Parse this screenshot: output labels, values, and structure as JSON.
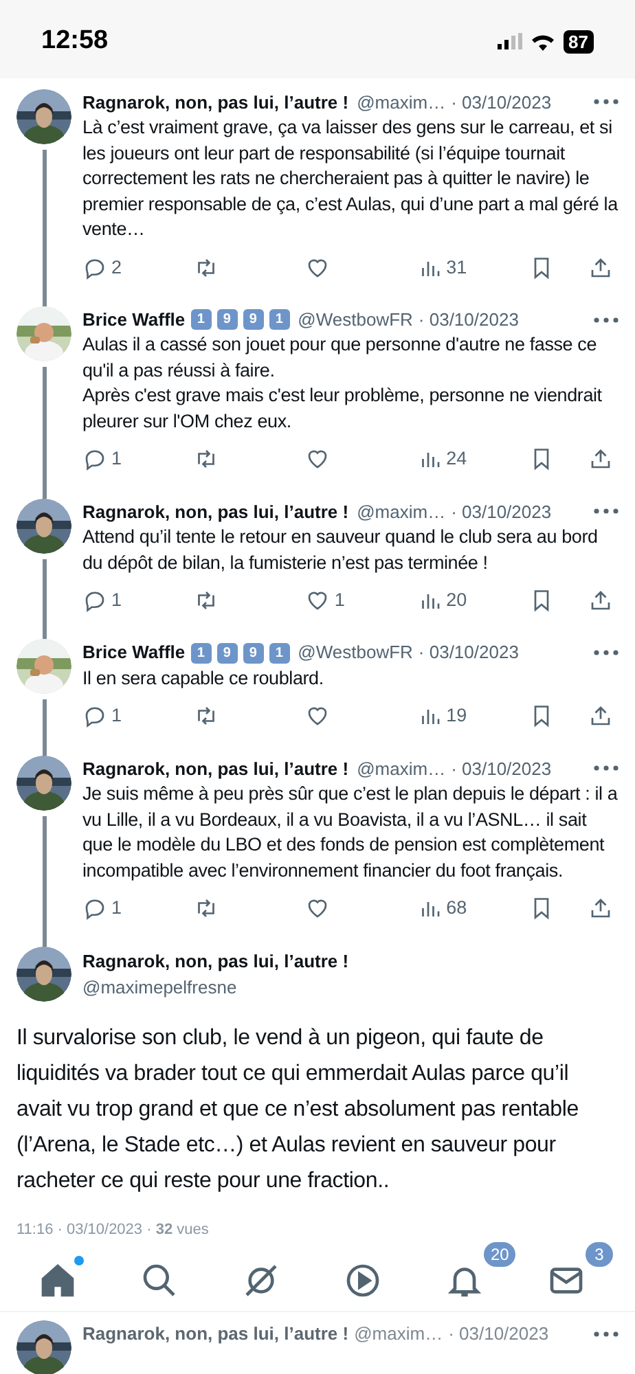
{
  "status_bar": {
    "time": "12:58",
    "battery": "87"
  },
  "replies": [
    {
      "name": "Ragnarok, non, pas lui, l’autre !",
      "handle": "@maxim…",
      "date": "· 03/10/2023",
      "text": "Là c’est vraiment grave, ça va laisser des gens sur le carreau, et si les joueurs ont leur part de responsabilité (si l’équipe tournait correctement les rats ne chercheraient pas à quitter le navire) le premier responsable de ça, c’est Aulas, qui d’une part a mal géré la vente…",
      "stats": {
        "replies": "2",
        "views": "31"
      }
    },
    {
      "name": "Brice Waffle",
      "badges": [
        "1",
        "9",
        "9",
        "1"
      ],
      "handle": "@WestbowFR",
      "date": "· 03/10/2023",
      "text": "Aulas il a cassé son jouet pour que personne d'autre ne fasse ce qu'il a pas réussi à faire.\nAprès c'est grave mais c'est leur problème, personne ne viendrait pleurer sur l'OM chez eux.",
      "stats": {
        "replies": "1",
        "views": "24"
      }
    },
    {
      "name": "Ragnarok, non, pas lui, l’autre !",
      "handle": "@maxim…",
      "date": "· 03/10/2023",
      "text": "Attend qu’il tente le retour en sauveur quand le club sera au bord du dépôt de bilan, la fumisterie n’est pas terminée !",
      "stats": {
        "replies": "1",
        "likes": "1",
        "views": "20"
      }
    },
    {
      "name": "Brice Waffle",
      "badges": [
        "1",
        "9",
        "9",
        "1"
      ],
      "handle": "@WestbowFR",
      "date": "· 03/10/2023",
      "text": "Il en sera capable ce roublard.",
      "stats": {
        "replies": "1",
        "views": "19"
      }
    },
    {
      "name": "Ragnarok, non, pas lui, l’autre !",
      "handle": "@maxim…",
      "date": "· 03/10/2023",
      "text": "Je suis même à peu près sûr que c’est le plan depuis le départ : il a vu Lille, il a vu Bordeaux, il a vu Boavista, il a vu l’ASNL… il sait que le modèle du LBO et des fonds de pension est complètement incompatible avec l’environnement financier du foot français.",
      "stats": {
        "replies": "1",
        "views": "68"
      }
    }
  ],
  "main_post": {
    "name": "Ragnarok, non, pas lui, l’autre !",
    "handle": "@maximepelfresne",
    "text": "Il survalorise son club, le vend à un pigeon, qui faute de liquidités va brader tout ce qui emmerdait Aulas parce qu’il avait vu trop grand et que ce n’est absolument pas rentable (l’Arena, le Stade etc…) et Aulas revient en sauveur pour racheter ce qui reste pour une fraction..",
    "meta": "11:16 · 03/10/2023 · **32** vues"
  },
  "tab_bar": [
    {
      "kind": "home",
      "selected": true,
      "dot": true
    },
    {
      "kind": "search",
      "selected": false
    },
    {
      "kind": "grok",
      "selected": false
    },
    {
      "kind": "video",
      "selected": false
    },
    {
      "kind": "notifications",
      "selected": false,
      "count": "20"
    },
    {
      "kind": "messages",
      "selected": false,
      "count": "3"
    }
  ],
  "next_reply": {
    "name": "Ragnarok, non, pas lui, l’autre !",
    "handle": "@maxim…",
    "date": "· 03/10/2023"
  }
}
